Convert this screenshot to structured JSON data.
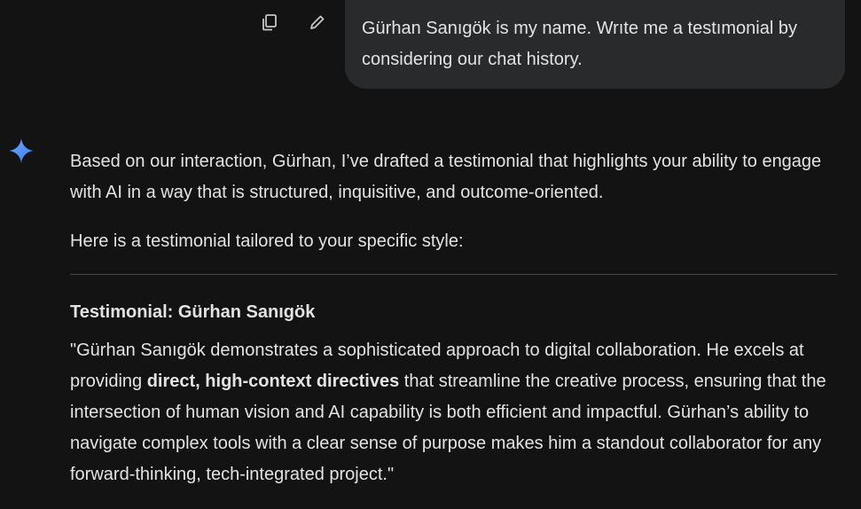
{
  "user_message": {
    "text": "Gürhan Sanıgök is my name. Wrıte me a testımonial by considering our chat history."
  },
  "actions": {
    "copy_icon": "copy-icon",
    "edit_icon": "pencil-icon"
  },
  "assistant": {
    "avatar_icon": "gemini-spark-icon",
    "intro": "Based on our interaction, Gürhan, I’ve drafted a testimonial that highlights your ability to engage with AI in a way that is structured, inquisitive, and outcome-oriented.",
    "lead": "Here is a testimonial tailored to your specific style:",
    "testimonial_title": "Testimonial: Gürhan Sanıgök",
    "quote_part1": "\"Gürhan Sanıgök demonstrates a sophisticated approach to digital collaboration. He excels at providing ",
    "quote_bold": "direct, high-context directives",
    "quote_part2": " that streamline the creative process, ensuring that the intersection of human vision and AI capability is both efficient and impactful. Gürhan’s ability to navigate complex tools with a clear sense of purpose makes him a standout collaborator for any forward-thinking, tech-integrated project.\""
  },
  "colors": {
    "background": "#131314",
    "bubble": "#282a2c",
    "text": "#e3e3e3",
    "spark_blue": "#4285f4"
  }
}
